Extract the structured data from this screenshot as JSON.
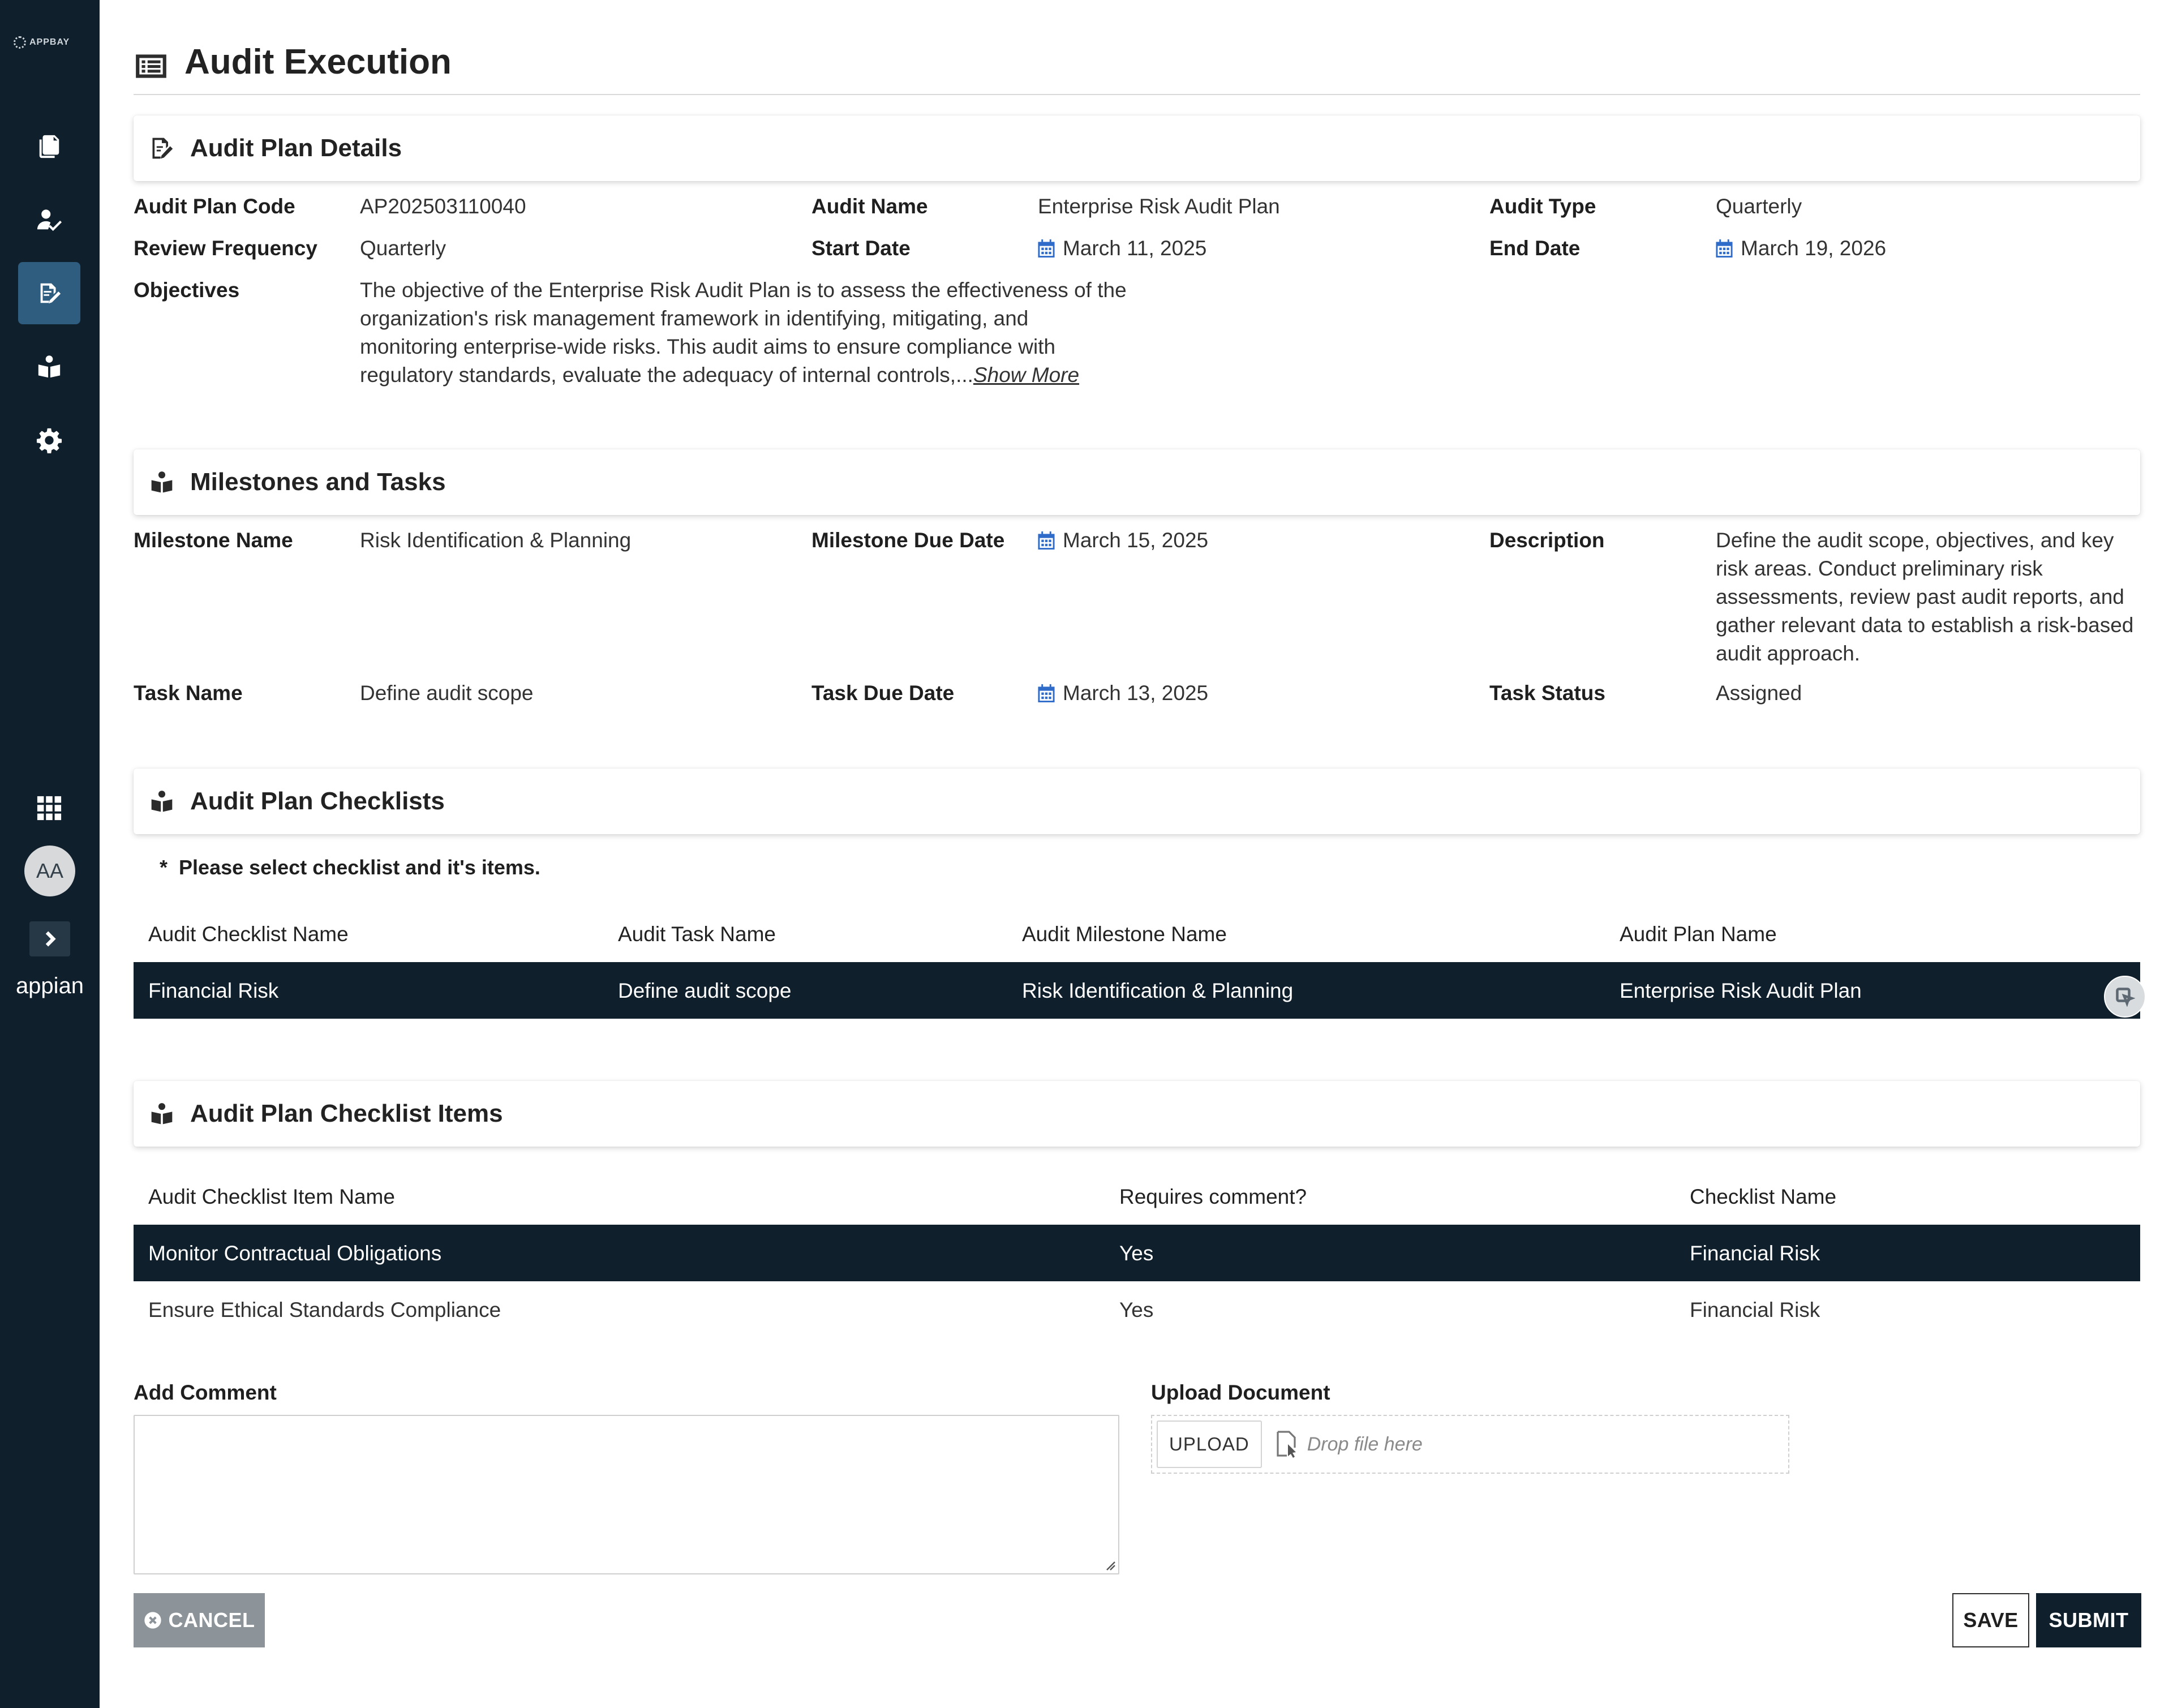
{
  "sidebar": {
    "logo_text": "APPBAY",
    "brand": "appian",
    "avatar_initials": "AA",
    "nav_icons": [
      "documents-icon",
      "user-check-icon",
      "edit-document-icon",
      "reader-icon",
      "gear-icon",
      "app-grid-icon"
    ],
    "active_index": 2
  },
  "page": {
    "title": "Audit Execution"
  },
  "plan_details": {
    "section_title": "Audit Plan Details",
    "fields": {
      "plan_code_label": "Audit Plan Code",
      "plan_code": "AP202503110040",
      "audit_name_label": "Audit Name",
      "audit_name": "Enterprise Risk Audit Plan",
      "audit_type_label": "Audit Type",
      "audit_type": "Quarterly",
      "review_frequency_label": "Review Frequency",
      "review_frequency": "Quarterly",
      "start_date_label": "Start Date",
      "start_date": "March 11, 2025",
      "end_date_label": "End Date",
      "end_date": "March 19, 2026",
      "objectives_label": "Objectives",
      "objectives_lines": [
        "The objective of the Enterprise Risk Audit Plan is to assess the effectiveness of the",
        "organization's risk management framework in identifying, mitigating, and",
        "monitoring enterprise-wide risks. This audit aims to ensure compliance with",
        "regulatory standards, evaluate the adequacy of internal controls,..."
      ],
      "show_more": "Show More"
    }
  },
  "milestones": {
    "section_title": "Milestones and Tasks",
    "milestone_name_label": "Milestone Name",
    "milestone_name": "Risk Identification & Planning",
    "milestone_due_label": "Milestone Due Date",
    "milestone_due": "March 15, 2025",
    "description_label": "Description",
    "description_lines": [
      "Define the audit scope, objectives, and key",
      "risk areas. Conduct preliminary risk",
      "assessments, review past audit reports, and",
      "gather relevant data to establish a risk-based",
      "audit approach."
    ],
    "task_name_label": "Task Name",
    "task_name": "Define audit scope",
    "task_due_label": "Task Due Date",
    "task_due": "March 13, 2025",
    "task_status_label": "Task Status",
    "task_status": "Assigned"
  },
  "checklists": {
    "section_title": "Audit Plan Checklists",
    "note_marker": "*",
    "note": "Please select checklist and it's items.",
    "columns": [
      "Audit Checklist Name",
      "Audit Task Name",
      "Audit Milestone Name",
      "Audit Plan Name"
    ],
    "rows": [
      [
        "Financial Risk",
        "Define audit scope",
        "Risk Identification & Planning",
        "Enterprise Risk Audit Plan"
      ]
    ]
  },
  "checklist_items": {
    "section_title": "Audit Plan Checklist Items",
    "columns": [
      "Audit Checklist Item Name",
      "Requires comment?",
      "Checklist Name"
    ],
    "rows": [
      [
        "Monitor Contractual Obligations",
        "Yes",
        "Financial Risk"
      ],
      [
        "Ensure Ethical Standards Compliance",
        "Yes",
        "Financial Risk"
      ]
    ],
    "selected_row": 0
  },
  "form": {
    "comment_label": "Add Comment",
    "comment_value": "",
    "upload_label": "Upload Document",
    "upload_button": "UPLOAD",
    "drop_text": "Drop file here"
  },
  "actions": {
    "cancel": "CANCEL",
    "save": "SAVE",
    "submit": "SUBMIT"
  },
  "colors": {
    "sidebar_bg": "#0f1f2c",
    "active_nav": "#2f5d80",
    "selected_row": "#0f1f2c",
    "date_icon": "#2f6cc9",
    "cancel_bg": "#8c949a"
  }
}
